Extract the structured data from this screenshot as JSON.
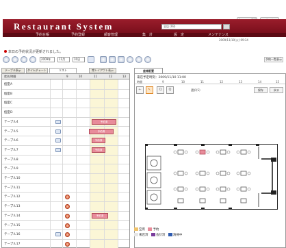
{
  "app": {
    "title": "Restaurant System",
    "nav": [
      "予約台帳",
      "予約登録",
      "顧客管理",
      "集　計",
      "設　定",
      "メンテナンス"
    ],
    "search_value": "全店 (FB)",
    "buttons": {
      "user_settings": "パスワード変更",
      "logout": "ログアウト"
    },
    "user_text": "ログイン：本店 管理者",
    "datetime": "2009/11/10(火) 09:34"
  },
  "notice": "本日の予約状況が更新されました。",
  "toolbar": {
    "year": "2009年",
    "month": "11月",
    "day": "10日",
    "right_button": "予約一覧表示"
  },
  "tabs": [
    "テーブル表示",
    "タイムチャート",
    "リスト",
    "席レイアウト表示"
  ],
  "right_tab": "座席配置",
  "grid": {
    "header_label": "席名/時間",
    "hours": [
      "9",
      "10",
      "11",
      "12",
      "13"
    ],
    "rows": [
      {
        "label": "個室A",
        "icon": ""
      },
      {
        "label": "個室B",
        "icon": ""
      },
      {
        "label": "個室C",
        "icon": ""
      },
      {
        "label": "個室D",
        "icon": ""
      },
      {
        "label": "テーブル4",
        "icon": "table"
      },
      {
        "label": "テーブル5",
        "icon": "table"
      },
      {
        "label": "テーブル6",
        "icon": "table"
      },
      {
        "label": "テーブル7",
        "icon": "table"
      },
      {
        "label": "テーブル8",
        "icon": ""
      },
      {
        "label": "テーブル9",
        "icon": ""
      },
      {
        "label": "テーブル10",
        "icon": ""
      },
      {
        "label": "テーブル11",
        "icon": ""
      },
      {
        "label": "テーブル12",
        "icon": "person"
      },
      {
        "label": "テーブル13",
        "icon": "person"
      },
      {
        "label": "テーブル14",
        "icon": "person"
      },
      {
        "label": "テーブル15",
        "icon": "person"
      },
      {
        "label": "テーブル16",
        "icon": "table-person"
      },
      {
        "label": "テーブル17",
        "icon": "person"
      }
    ],
    "bookings": [
      {
        "row": 4,
        "label": "予約済"
      },
      {
        "row": 5,
        "label": "予約済"
      },
      {
        "row": 6,
        "label": "予約済"
      },
      {
        "row": 7,
        "label": "予約済"
      },
      {
        "row": 14,
        "label": "予約済"
      }
    ]
  },
  "panel": {
    "info": "来店予定時刻：2009/11/10 11:00",
    "scale_labels": [
      "時間",
      "9",
      "10",
      "11",
      "12",
      "13",
      "14",
      "15"
    ],
    "tools": [
      "←",
      "↖",
      "Q",
      "Q"
    ],
    "tool_text": "選択(S)",
    "right_buttons": [
      "保存",
      "戻る"
    ]
  },
  "legend": {
    "row1": [
      "空席",
      "予約"
    ],
    "row2": [
      "来店済",
      "会計済",
      "清掃中"
    ]
  },
  "colors": {
    "brand_red": "#9a1d2b",
    "booking": "#e88c9a",
    "highlight": "#fbf6d6"
  }
}
